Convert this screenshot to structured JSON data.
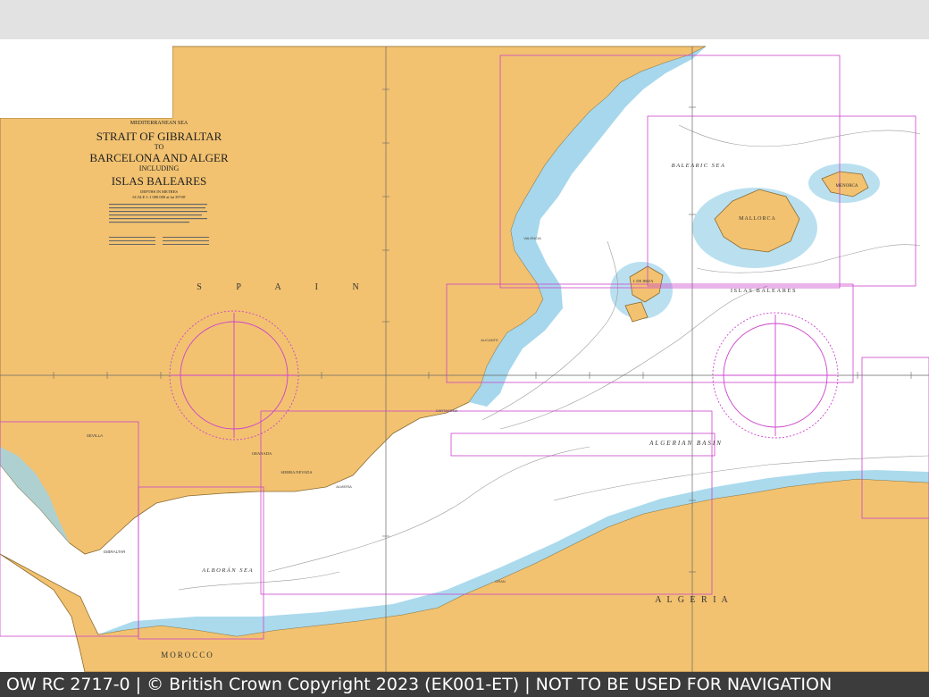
{
  "chart_title": {
    "sea": "MEDITERRANEAN SEA",
    "line1": "STRAIT OF GIBRALTAR",
    "line2": "TO",
    "line3": "BARCELONA AND ALGER",
    "line4": "INCLUDING",
    "line5": "ISLAS BALEARES",
    "depths": "DEPTHS IN METRES",
    "scale": "SCALE 1:1 000 000 at lat 39°00'"
  },
  "labels": {
    "spain": "S P A I N",
    "algeria": "A L G E R I A",
    "morocco": "MOROCCO",
    "balearic_sea": "BALEARIC SEA",
    "islas_baleares": "ISLAS BALEARES",
    "algerian_basin": "ALGERIAN BASIN",
    "alboran_sea": "ALBORÁN SEA",
    "mallorca": "MALLORCA",
    "menorca": "MENORCA",
    "ibiza": "I. DE IBIZA",
    "sierra_nevada": "SIERRA NEVADA",
    "granada": "GRANADA",
    "gibraltar": "GIBRALTAR",
    "sevilla": "SEVILLA",
    "alicante": "ALICANTE",
    "valencia": "VALENCIA",
    "cartagena": "CARTAGENA",
    "almeria": "ALMERÍA",
    "oran": "ORAN"
  },
  "colors": {
    "land": "#f2c270",
    "shallow_water": "#9cd3ea",
    "mid_water": "#d3ecf6",
    "deep_water": "#ffffff",
    "limits": "#cc44cc",
    "grid": "#666666",
    "footer_bg": "#3c3c3c"
  },
  "footer": {
    "text": "OW RC 2717-0 | © British Crown Copyright 2023 (EK001-ET) | NOT TO BE USED FOR NAVIGATION"
  }
}
